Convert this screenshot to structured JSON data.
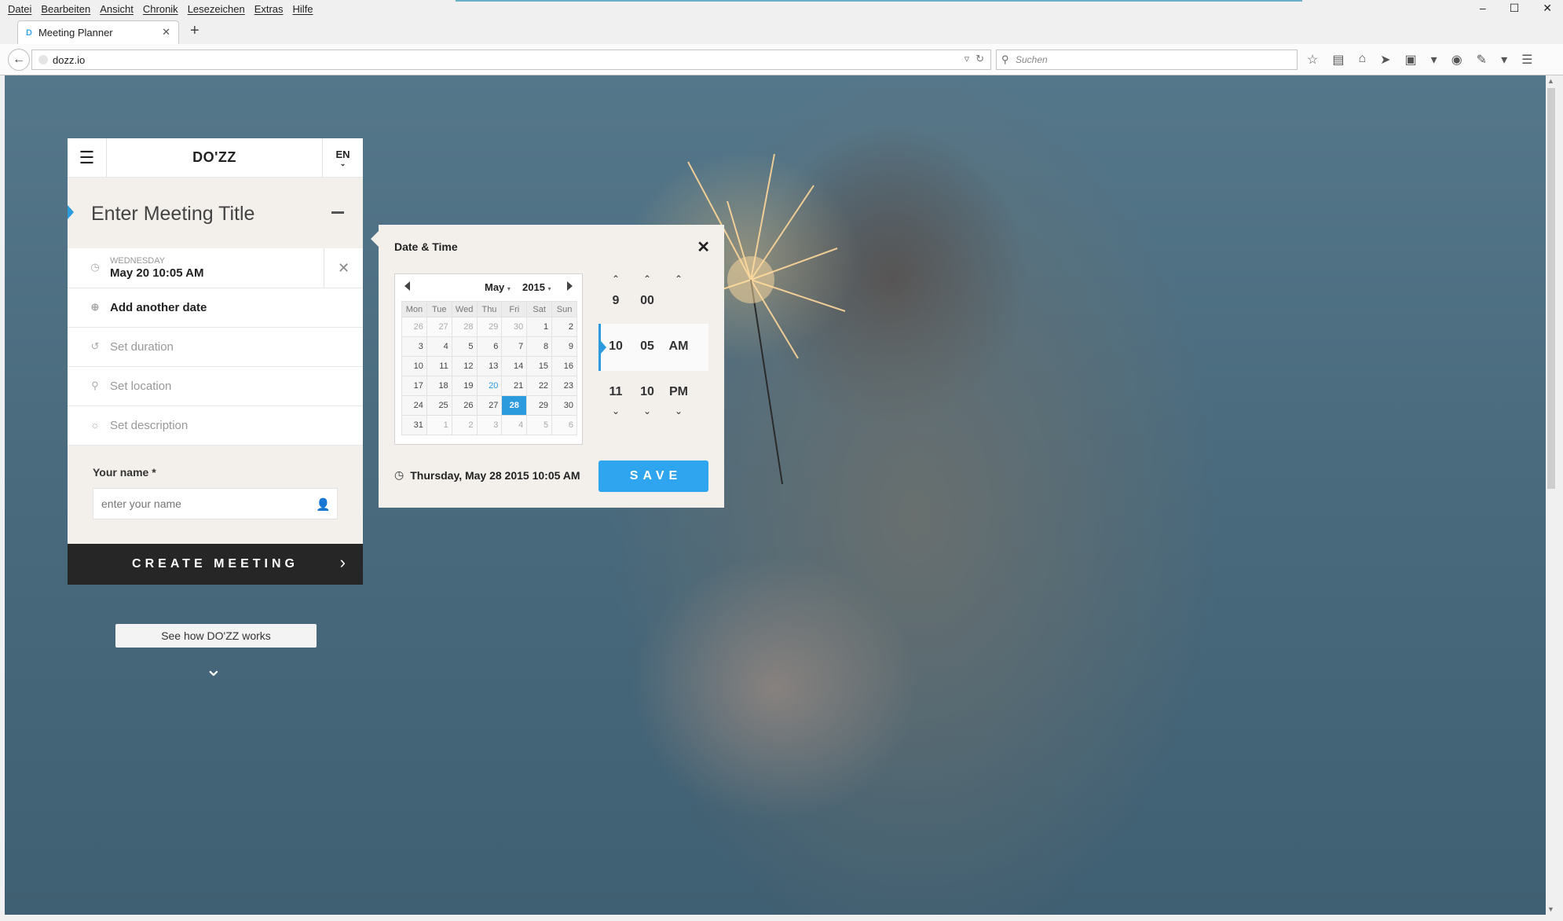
{
  "browser": {
    "menus": [
      "Datei",
      "Bearbeiten",
      "Ansicht",
      "Chronik",
      "Lesezeichen",
      "Extras",
      "Hilfe"
    ],
    "tab_title": "Meeting Planner",
    "tab_favicon": "D",
    "url": "dozz.io",
    "search_placeholder": "Suchen",
    "accent_color": "#2b9bde"
  },
  "panel": {
    "logo": "DO'ZZ",
    "language": "EN",
    "meeting_title_placeholder": "Enter Meeting Title",
    "date_day": "WEDNESDAY",
    "date_value": "May 20 10:05 AM",
    "add_date": "Add another date",
    "set_duration": "Set duration",
    "set_location": "Set location",
    "set_description": "Set description",
    "name_label": "Your name *",
    "name_placeholder": "enter your name",
    "create_button": "CREATE MEETING"
  },
  "see_how": "See how DO'ZZ works",
  "datetime": {
    "title": "Date & Time",
    "month": "May",
    "year": "2015",
    "weekdays": [
      "Mon",
      "Tue",
      "Wed",
      "Thu",
      "Fri",
      "Sat",
      "Sun"
    ],
    "weeks": [
      [
        "26",
        "27",
        "28",
        "29",
        "30",
        "1",
        "2"
      ],
      [
        "3",
        "4",
        "5",
        "6",
        "7",
        "8",
        "9"
      ],
      [
        "10",
        "11",
        "12",
        "13",
        "14",
        "15",
        "16"
      ],
      [
        "17",
        "18",
        "19",
        "20",
        "21",
        "22",
        "23"
      ],
      [
        "24",
        "25",
        "26",
        "27",
        "28",
        "29",
        "30"
      ],
      [
        "31",
        "1",
        "2",
        "3",
        "4",
        "5",
        "6"
      ]
    ],
    "selected_day": "28",
    "today_day": "20",
    "hour_prev": "9",
    "hour": "10",
    "hour_next": "11",
    "minute_prev": "00",
    "minute": "05",
    "minute_next": "10",
    "ampm": "AM",
    "ampm_next": "PM",
    "summary": "Thursday, May 28 2015 10:05 AM",
    "save_button": "SAVE"
  }
}
